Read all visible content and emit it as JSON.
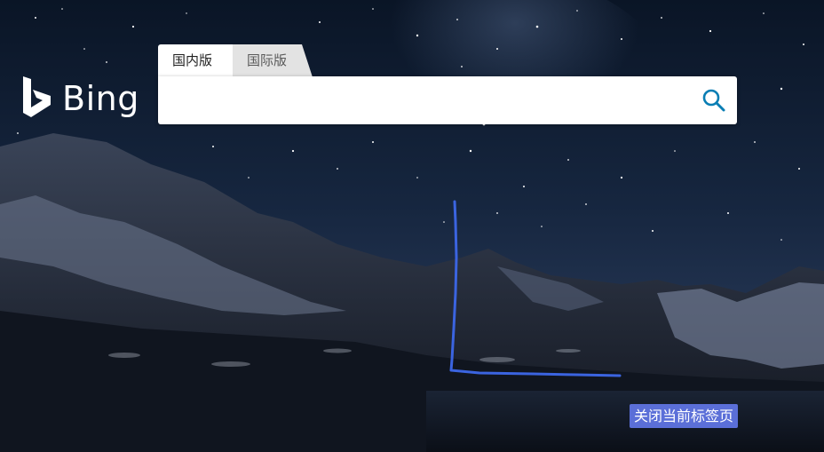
{
  "logo": {
    "text": "Bing"
  },
  "tabs": [
    {
      "label": "国内版",
      "selected": true
    },
    {
      "label": "国际版",
      "selected": false
    }
  ],
  "search": {
    "value": "",
    "placeholder": "",
    "icon": "search-icon"
  },
  "overlay": {
    "close_tab_label": "关闭当前标签页",
    "annotation_color": "#3b64e0"
  },
  "colors": {
    "accent": "#0a7eb4",
    "button_bg": "#5b6fd8"
  }
}
